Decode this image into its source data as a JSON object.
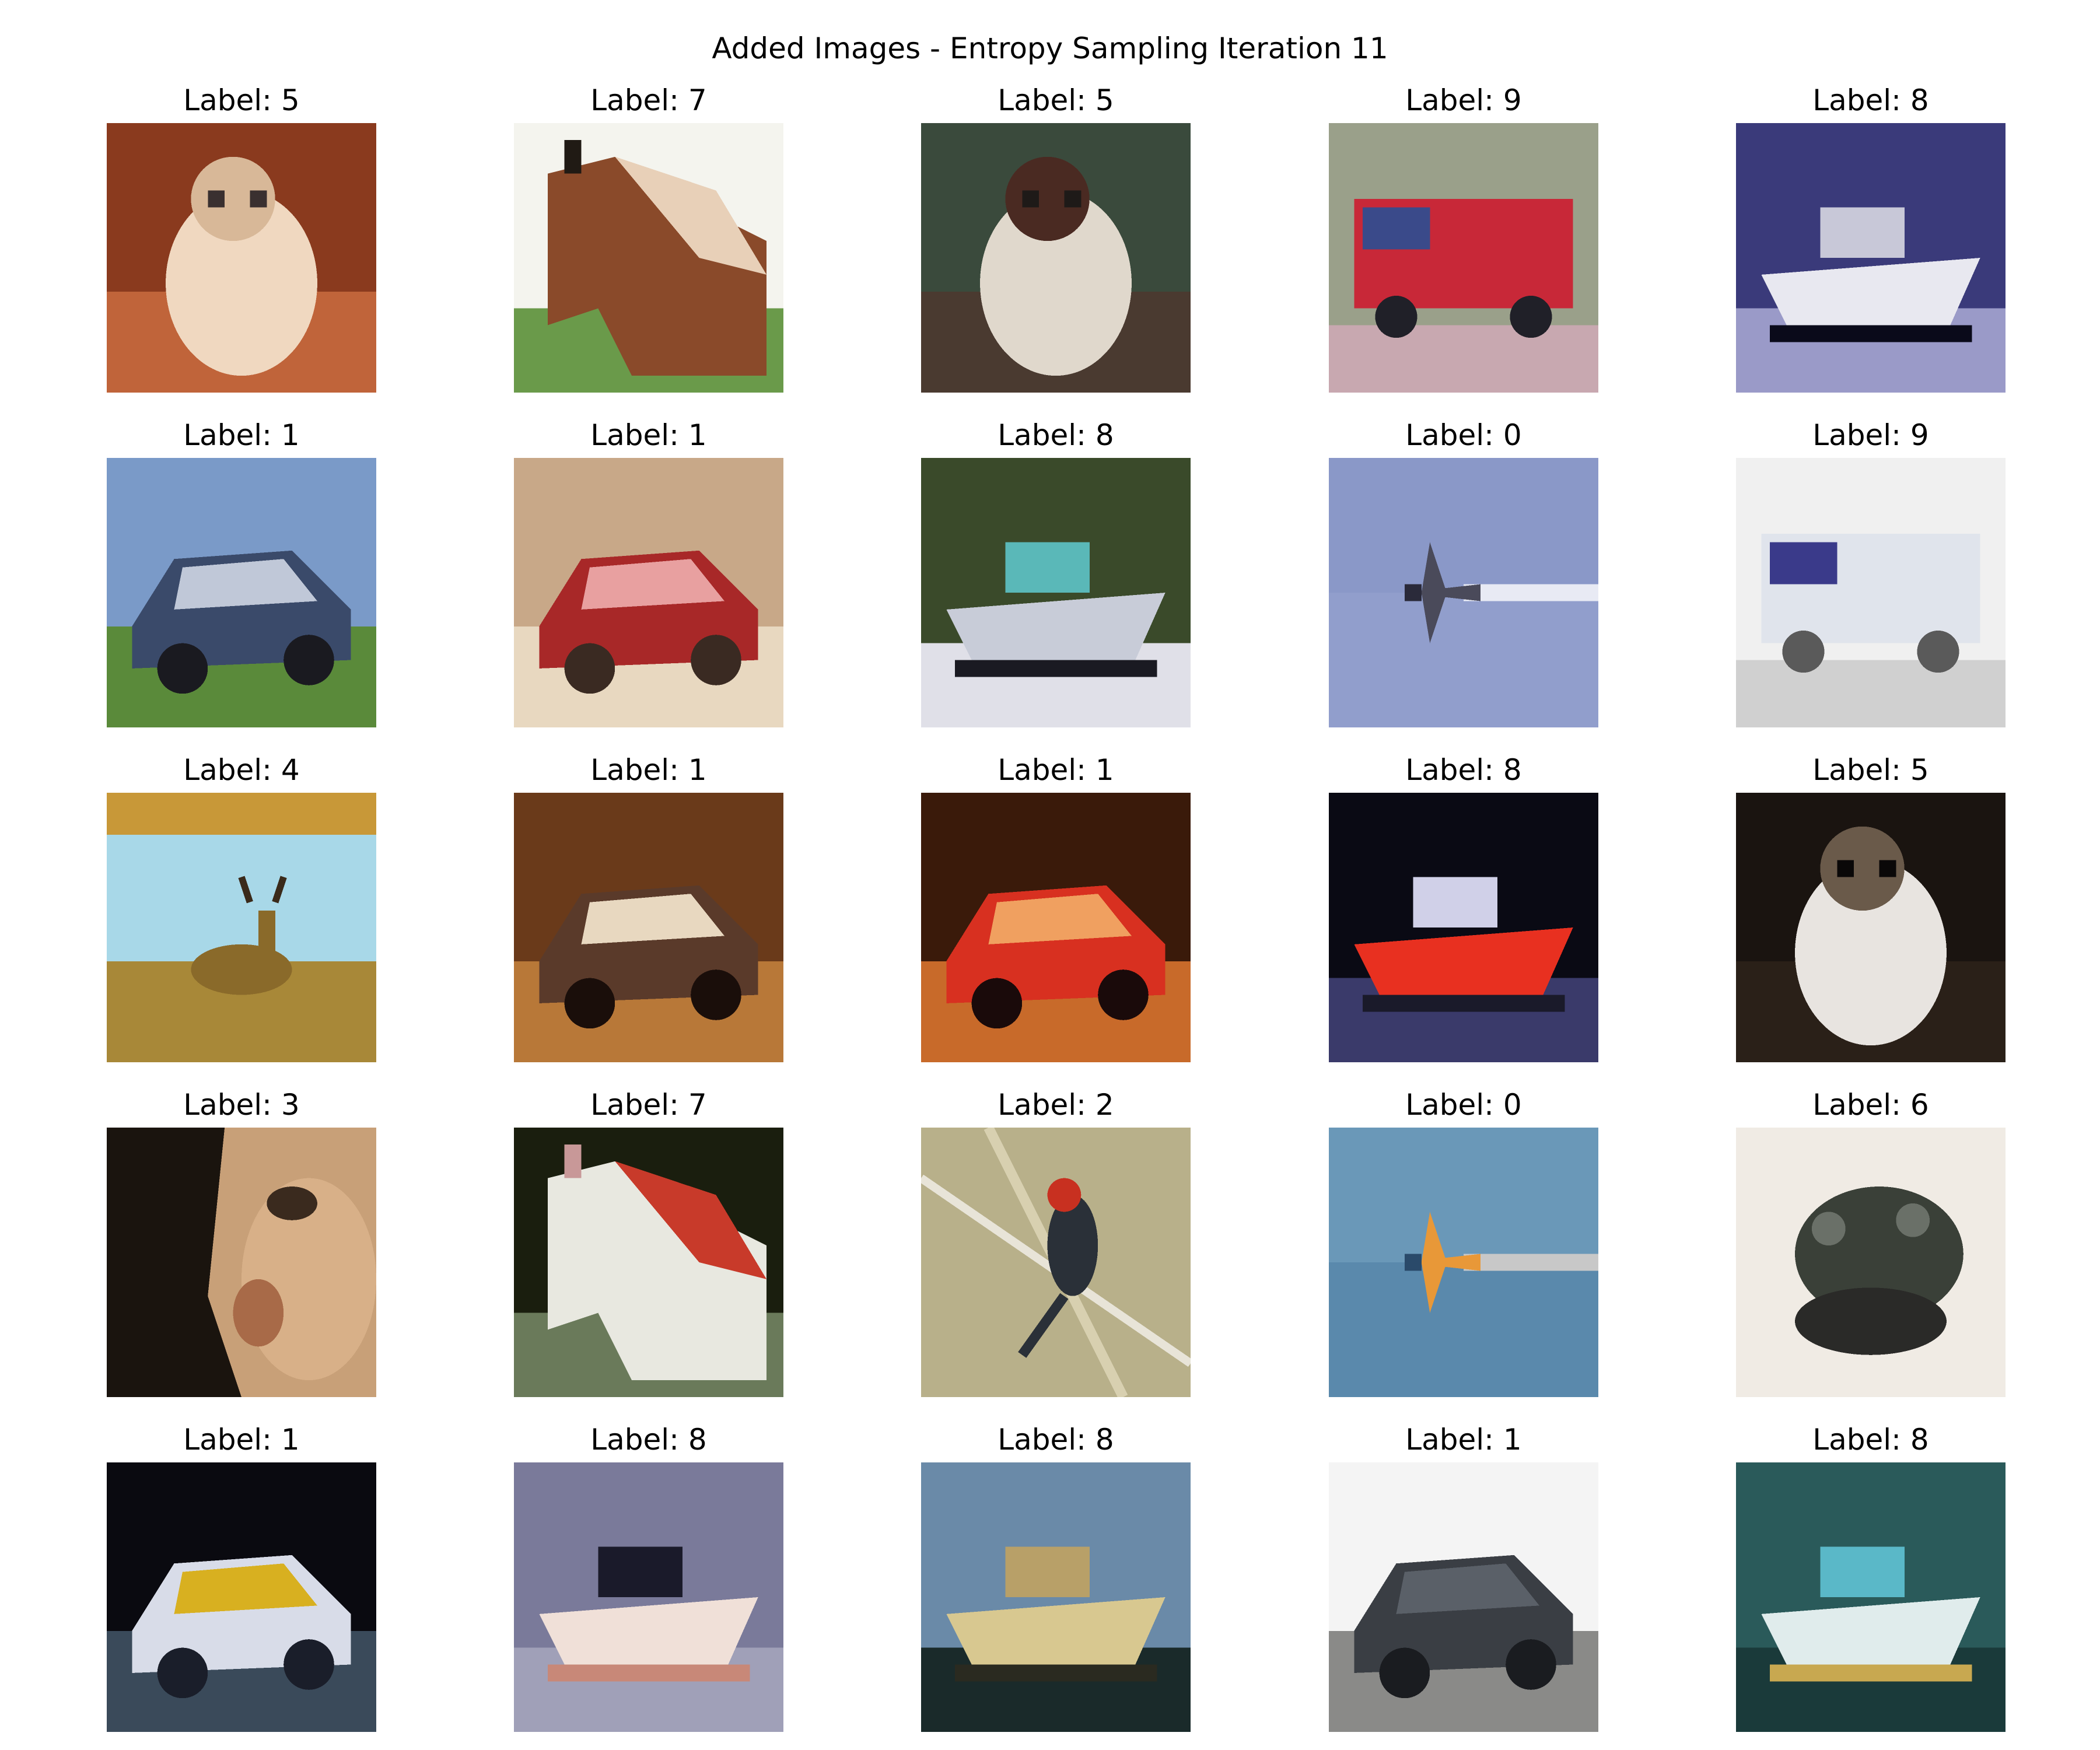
{
  "title": "Added Images - Entropy Sampling Iteration 11",
  "label_prefix": "Label: ",
  "images": [
    {
      "label": "5",
      "subject": "dog",
      "colors": {
        "bg": "#8a3a1e",
        "bg2": "#c0643a",
        "fg": "#f0d8c0",
        "fg2": "#d8b898",
        "accent": "#3a3030"
      }
    },
    {
      "label": "7",
      "subject": "horse",
      "colors": {
        "bg": "#f4f4ee",
        "bg2": "#6a9a4a",
        "fg": "#8a4a2a",
        "fg2": "#e8d0b8",
        "accent": "#201a14"
      }
    },
    {
      "label": "5",
      "subject": "dog",
      "colors": {
        "bg": "#3a4a3c",
        "bg2": "#4a3a30",
        "fg": "#e0d8cc",
        "fg2": "#4a2a22",
        "accent": "#1e1a18"
      }
    },
    {
      "label": "9",
      "subject": "truck",
      "colors": {
        "bg": "#9aa08a",
        "bg2": "#c8a8b0",
        "fg": "#c82838",
        "fg2": "#3a4a8a",
        "accent": "#202028"
      }
    },
    {
      "label": "8",
      "subject": "ship",
      "colors": {
        "bg": "#3a3a7a",
        "bg2": "#9a9ac8",
        "fg": "#e8e8f0",
        "fg2": "#c8c8d8",
        "accent": "#0a0a1a"
      }
    },
    {
      "label": "1",
      "subject": "car",
      "colors": {
        "bg": "#7a9ac8",
        "bg2": "#5a8a3a",
        "fg": "#3a4a6a",
        "fg2": "#c0c8d8",
        "accent": "#1a1a20"
      }
    },
    {
      "label": "1",
      "subject": "car",
      "colors": {
        "bg": "#c8a888",
        "bg2": "#e8d8c0",
        "fg": "#a82828",
        "fg2": "#e8a0a0",
        "accent": "#3a2a22"
      }
    },
    {
      "label": "8",
      "subject": "ship",
      "colors": {
        "bg": "#3a4a2a",
        "bg2": "#e0e0e8",
        "fg": "#c8ccd8",
        "fg2": "#5ab8b8",
        "accent": "#1a1a22"
      }
    },
    {
      "label": "0",
      "subject": "airplane",
      "colors": {
        "bg": "#8a98c8",
        "bg2": "#98a4d0",
        "fg": "#4a4a5a",
        "fg2": "#e8eaf4",
        "accent": "#2a2a3a"
      }
    },
    {
      "label": "9",
      "subject": "truck",
      "colors": {
        "bg": "#f0f0f0",
        "bg2": "#d0d0d0",
        "fg": "#e0e4ec",
        "fg2": "#3a3a8a",
        "accent": "#5a5a5a"
      }
    },
    {
      "label": "4",
      "subject": "deer",
      "colors": {
        "bg": "#a8d8e8",
        "bg2": "#c89838",
        "fg": "#a88838",
        "fg2": "#8a6a2a",
        "accent": "#3a2a1a"
      }
    },
    {
      "label": "1",
      "subject": "car",
      "colors": {
        "bg": "#6a3a1a",
        "bg2": "#b87838",
        "fg": "#5a3a2a",
        "fg2": "#e8d8c0",
        "accent": "#1a0e0a"
      }
    },
    {
      "label": "1",
      "subject": "car",
      "colors": {
        "bg": "#3a1a0a",
        "bg2": "#c86a2a",
        "fg": "#d83020",
        "fg2": "#f0a060",
        "accent": "#1a0a0a"
      }
    },
    {
      "label": "8",
      "subject": "ship",
      "colors": {
        "bg": "#0a0a14",
        "bg2": "#3a3a6a",
        "fg": "#e83020",
        "fg2": "#d0d0e8",
        "accent": "#1a1a2a"
      }
    },
    {
      "label": "5",
      "subject": "dog",
      "colors": {
        "bg": "#1a1410",
        "bg2": "#2a2018",
        "fg": "#e8e4e0",
        "fg2": "#6a5a4a",
        "accent": "#0a0808"
      }
    },
    {
      "label": "3",
      "subject": "cat",
      "colors": {
        "bg": "#1a140e",
        "bg2": "#c8a078",
        "fg": "#d8b088",
        "fg2": "#a86a48",
        "accent": "#3a2a1e"
      }
    },
    {
      "label": "7",
      "subject": "horse",
      "colors": {
        "bg": "#1a1e0e",
        "bg2": "#6a7a5a",
        "fg": "#e8e8e0",
        "fg2": "#c83a2a",
        "accent": "#c89898"
      }
    },
    {
      "label": "2",
      "subject": "bird",
      "colors": {
        "bg": "#b8b08a",
        "bg2": "#d8d0b0",
        "fg": "#2a3038",
        "fg2": "#c83020",
        "accent": "#e8e4d8"
      }
    },
    {
      "label": "0",
      "subject": "airplane",
      "colors": {
        "bg": "#6a98b8",
        "bg2": "#4a7aa0",
        "fg": "#e89838",
        "fg2": "#c8c8c8",
        "accent": "#2a4a6a"
      }
    },
    {
      "label": "6",
      "subject": "frog",
      "colors": {
        "bg": "#f0ebe4",
        "bg2": "#d8d0c8",
        "fg": "#3a4038",
        "fg2": "#2a2a28",
        "accent": "#6a7068"
      }
    },
    {
      "label": "1",
      "subject": "car",
      "colors": {
        "bg": "#0a0a10",
        "bg2": "#3a4a5a",
        "fg": "#d8dce8",
        "fg2": "#d8b020",
        "accent": "#1a1e2a"
      }
    },
    {
      "label": "8",
      "subject": "ship",
      "colors": {
        "bg": "#7a7a9a",
        "bg2": "#a0a0b8",
        "fg": "#f0e0d8",
        "fg2": "#1a1a2a",
        "accent": "#c88878"
      }
    },
    {
      "label": "8",
      "subject": "ship",
      "colors": {
        "bg": "#6a8aa8",
        "bg2": "#1a2a2a",
        "fg": "#d8c890",
        "fg2": "#b8a068",
        "accent": "#2a2a20"
      }
    },
    {
      "label": "1",
      "subject": "car",
      "colors": {
        "bg": "#f4f4f4",
        "bg2": "#8a8a88",
        "fg": "#3a3e44",
        "fg2": "#5a6068",
        "accent": "#1a1c20"
      }
    },
    {
      "label": "8",
      "subject": "ship",
      "colors": {
        "bg": "#2a5a5a",
        "bg2": "#1a3a3a",
        "fg": "#e0ecec",
        "fg2": "#5ab8c8",
        "accent": "#c8a850"
      }
    }
  ]
}
